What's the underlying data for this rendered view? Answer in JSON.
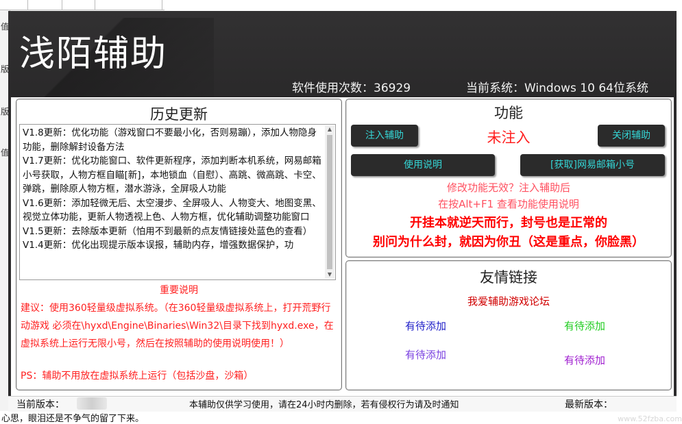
{
  "app": {
    "title": "浅陌辅助",
    "usage_count": "软件使用次数：36929",
    "system_info": "当前系统：Windows 10   64位系统"
  },
  "history": {
    "title": "历史更新",
    "entries": [
      "V1.8更新：优化功能（游戏窗口不要最小化，否则易蹦），添加人物隐身功能，删除解封设备方法",
      "V1.7更新：优化功能窗口、软件更新程序，添加判断本机系统，网易邮箱小号获取，人物方框自瞄[新]，本地锁血（自慰）、高跳、微高跳、卡空、弹跳，删除原人物方框，潜水游泳，全屏吸人功能",
      "V1.6更新：添加轻微无后、太空漫步、全屏吸人、人物变大、地图变黑、视觉立体功能，更新人物透视上色、人物方框，优化辅助调整功能窗口",
      "V1.5更新：去除版本更新（怕用不到最新的点友情链接处蓝色的查看）",
      "V1.4更新：优化出现提示版本误报，辅助内存，增强数据保护，功"
    ],
    "important_title": "重要说明",
    "advice": "建议：使用360轻量级虚拟系统。（在360轻量级虚拟系统上，打开荒野行动游戏 必须在\\hyxd\\Engine\\Binaries\\Win32\\目录下找到hyxd.exe，在虚拟系统上运行无限小号，然后在按照辅助的使用说明使用！）",
    "ps": "PS：辅助不用放在虚拟系统上运行（包括沙盘，沙箱）"
  },
  "features": {
    "title": "功能",
    "inject_label": "注入辅助",
    "close_label": "关闭辅助",
    "status": "未注入",
    "help_label": "使用说明",
    "mail_label": "[获取]网易邮箱小号",
    "tip1": "修改功能无效？注入辅助后",
    "tip2": "在按Alt+F1 查看功能使用说明",
    "warn1": "开挂本就逆天而行，封号也是正常的",
    "warn2": "别问为什么封，就因为你丑（这是重点，你脸黑）"
  },
  "links": {
    "title": "友情链接",
    "forum": "我爱辅助游戏论坛",
    "items": [
      "有待添加",
      "有待添加",
      "有待添加",
      "有待添加"
    ]
  },
  "statusbar": {
    "current_version_label": "当前版本：",
    "disclaimer": "本辅助仅供学习使用，请在24小时内删除，若有侵权行为请及时通知",
    "latest_version_label": "最新版本："
  },
  "background": {
    "bottom_text": "心思，眼泪还是不争气的留了下来。",
    "watermark": "www.52fzba.com"
  },
  "colors": {
    "window_dark": "#2b2a2b",
    "button_text": "#34d6d6",
    "warning_red": "#ff0000"
  }
}
